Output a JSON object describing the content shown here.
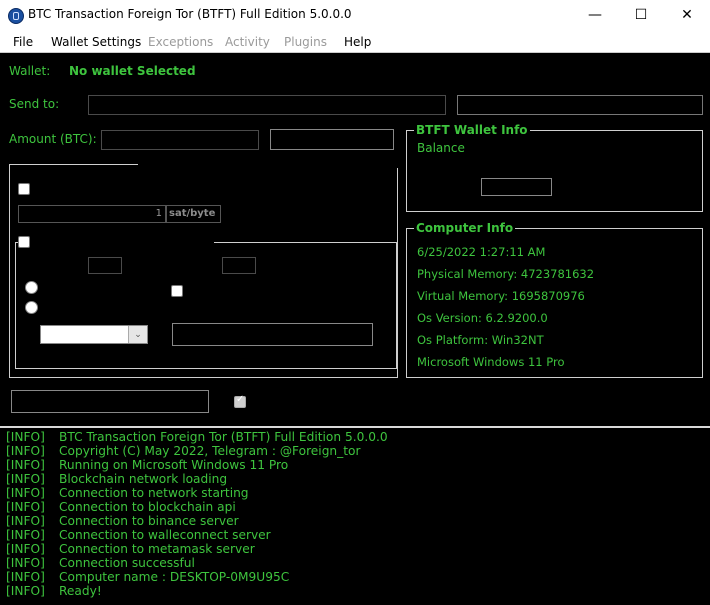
{
  "window": {
    "title": "BTC Transaction Foreign Tor (BTFT) Full Edition 5.0.0.0",
    "minimize_glyph": "—",
    "maximize_glyph": "☐",
    "close_glyph": "✕"
  },
  "menu": {
    "file": "File",
    "wallet_settings": "Wallet Settings",
    "exceptions": "Exceptions",
    "activity": "Activity",
    "plugins": "Plugins",
    "help": "Help"
  },
  "main": {
    "wallet_label": "Wallet:",
    "wallet_value": "No wallet Selected",
    "send_to_label": "Send to:",
    "amount_label": "Amount (BTC):",
    "fee_value": "1",
    "fee_unit": "sat/byte"
  },
  "wallet_info": {
    "title": "BTFT Wallet Info",
    "balance_label": "Balance"
  },
  "computer_info": {
    "title": "Computer Info",
    "lines": [
      "6/25/2022 1:27:11 AM",
      "Physical Memory: 4723781632",
      "Virtual Memory: 1695870976",
      "Os Version: 6.2.9200.0",
      "Os Platform: Win32NT",
      "Microsoft Windows 11 Pro"
    ]
  },
  "log": {
    "tag": "[INFO]",
    "lines": [
      "BTC Transaction Foreign Tor (BTFT) Full Edition 5.0.0.0",
      "Copyright (C) May 2022, Telegram : @Foreign_tor",
      "Running on Microsoft Windows 11 Pro",
      "Blockchain network loading",
      "Connection to network starting",
      "Connection to blockchain api",
      "Connection to binance server",
      "Connection to walleconnect server",
      "Connection to metamask server",
      "Connection successful",
      "Computer name : DESKTOP-0M9U95C",
      "Ready!"
    ]
  },
  "colors": {
    "accent_green": "#3ec43e",
    "background": "#000000"
  }
}
